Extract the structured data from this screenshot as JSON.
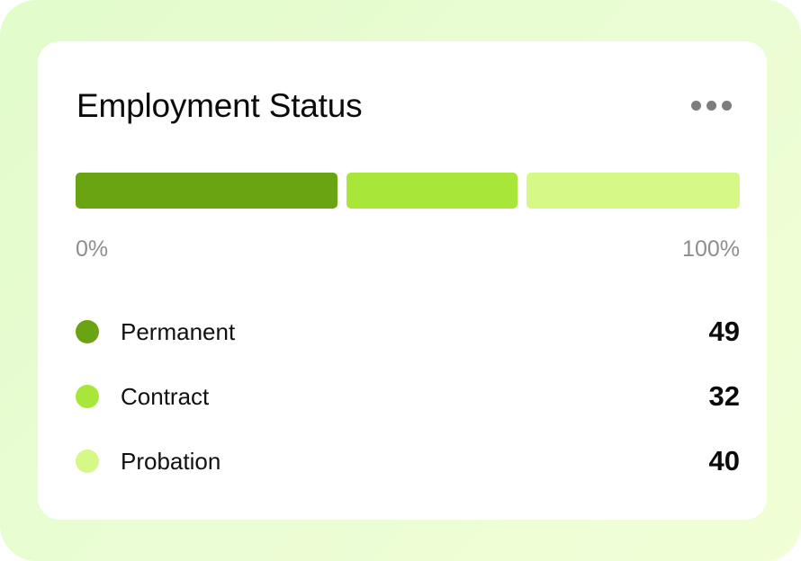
{
  "card": {
    "title": "Employment Status",
    "menu_icon": "more-horizontal-icon"
  },
  "scale": {
    "min_label": "0%",
    "max_label": "100%"
  },
  "colors": {
    "background": "#e6fccf",
    "card": "#ffffff",
    "permanent": "#6ba413",
    "contract": "#a8e63a",
    "probation": "#d5f887",
    "muted_text": "#8e8e8e"
  },
  "chart_data": {
    "type": "bar",
    "categories": [
      "Permanent",
      "Contract",
      "Probation"
    ],
    "values": [
      49,
      32,
      40
    ]
  },
  "legend": [
    {
      "label": "Permanent",
      "value": "49",
      "color": "#6ba413"
    },
    {
      "label": "Contract",
      "value": "32",
      "color": "#a8e63a"
    },
    {
      "label": "Probation",
      "value": "40",
      "color": "#d5f887"
    }
  ]
}
